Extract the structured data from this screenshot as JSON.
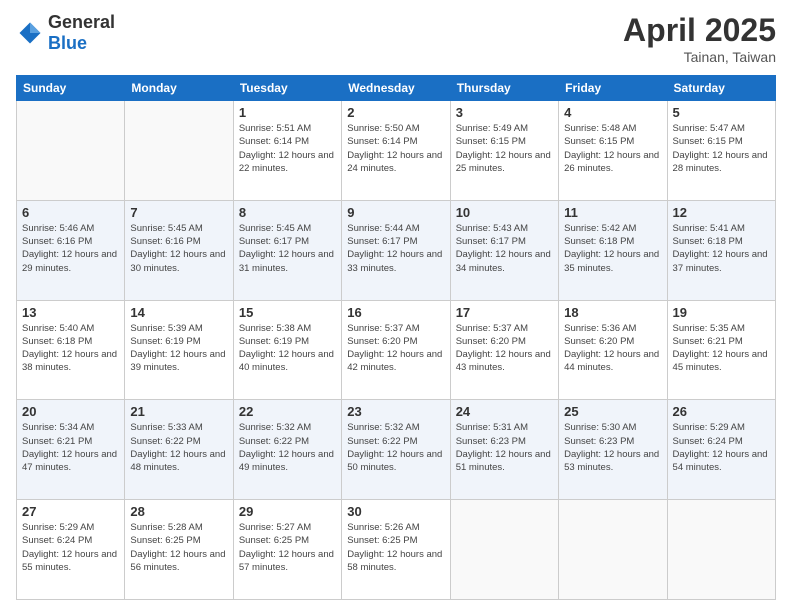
{
  "header": {
    "logo_general": "General",
    "logo_blue": "Blue",
    "title": "April 2025",
    "subtitle": "Tainan, Taiwan"
  },
  "days_of_week": [
    "Sunday",
    "Monday",
    "Tuesday",
    "Wednesday",
    "Thursday",
    "Friday",
    "Saturday"
  ],
  "weeks": [
    {
      "alt": false,
      "days": [
        {
          "num": "",
          "sunrise": "",
          "sunset": "",
          "daylight": ""
        },
        {
          "num": "",
          "sunrise": "",
          "sunset": "",
          "daylight": ""
        },
        {
          "num": "1",
          "sunrise": "Sunrise: 5:51 AM",
          "sunset": "Sunset: 6:14 PM",
          "daylight": "Daylight: 12 hours and 22 minutes."
        },
        {
          "num": "2",
          "sunrise": "Sunrise: 5:50 AM",
          "sunset": "Sunset: 6:14 PM",
          "daylight": "Daylight: 12 hours and 24 minutes."
        },
        {
          "num": "3",
          "sunrise": "Sunrise: 5:49 AM",
          "sunset": "Sunset: 6:15 PM",
          "daylight": "Daylight: 12 hours and 25 minutes."
        },
        {
          "num": "4",
          "sunrise": "Sunrise: 5:48 AM",
          "sunset": "Sunset: 6:15 PM",
          "daylight": "Daylight: 12 hours and 26 minutes."
        },
        {
          "num": "5",
          "sunrise": "Sunrise: 5:47 AM",
          "sunset": "Sunset: 6:15 PM",
          "daylight": "Daylight: 12 hours and 28 minutes."
        }
      ]
    },
    {
      "alt": true,
      "days": [
        {
          "num": "6",
          "sunrise": "Sunrise: 5:46 AM",
          "sunset": "Sunset: 6:16 PM",
          "daylight": "Daylight: 12 hours and 29 minutes."
        },
        {
          "num": "7",
          "sunrise": "Sunrise: 5:45 AM",
          "sunset": "Sunset: 6:16 PM",
          "daylight": "Daylight: 12 hours and 30 minutes."
        },
        {
          "num": "8",
          "sunrise": "Sunrise: 5:45 AM",
          "sunset": "Sunset: 6:17 PM",
          "daylight": "Daylight: 12 hours and 31 minutes."
        },
        {
          "num": "9",
          "sunrise": "Sunrise: 5:44 AM",
          "sunset": "Sunset: 6:17 PM",
          "daylight": "Daylight: 12 hours and 33 minutes."
        },
        {
          "num": "10",
          "sunrise": "Sunrise: 5:43 AM",
          "sunset": "Sunset: 6:17 PM",
          "daylight": "Daylight: 12 hours and 34 minutes."
        },
        {
          "num": "11",
          "sunrise": "Sunrise: 5:42 AM",
          "sunset": "Sunset: 6:18 PM",
          "daylight": "Daylight: 12 hours and 35 minutes."
        },
        {
          "num": "12",
          "sunrise": "Sunrise: 5:41 AM",
          "sunset": "Sunset: 6:18 PM",
          "daylight": "Daylight: 12 hours and 37 minutes."
        }
      ]
    },
    {
      "alt": false,
      "days": [
        {
          "num": "13",
          "sunrise": "Sunrise: 5:40 AM",
          "sunset": "Sunset: 6:18 PM",
          "daylight": "Daylight: 12 hours and 38 minutes."
        },
        {
          "num": "14",
          "sunrise": "Sunrise: 5:39 AM",
          "sunset": "Sunset: 6:19 PM",
          "daylight": "Daylight: 12 hours and 39 minutes."
        },
        {
          "num": "15",
          "sunrise": "Sunrise: 5:38 AM",
          "sunset": "Sunset: 6:19 PM",
          "daylight": "Daylight: 12 hours and 40 minutes."
        },
        {
          "num": "16",
          "sunrise": "Sunrise: 5:37 AM",
          "sunset": "Sunset: 6:20 PM",
          "daylight": "Daylight: 12 hours and 42 minutes."
        },
        {
          "num": "17",
          "sunrise": "Sunrise: 5:37 AM",
          "sunset": "Sunset: 6:20 PM",
          "daylight": "Daylight: 12 hours and 43 minutes."
        },
        {
          "num": "18",
          "sunrise": "Sunrise: 5:36 AM",
          "sunset": "Sunset: 6:20 PM",
          "daylight": "Daylight: 12 hours and 44 minutes."
        },
        {
          "num": "19",
          "sunrise": "Sunrise: 5:35 AM",
          "sunset": "Sunset: 6:21 PM",
          "daylight": "Daylight: 12 hours and 45 minutes."
        }
      ]
    },
    {
      "alt": true,
      "days": [
        {
          "num": "20",
          "sunrise": "Sunrise: 5:34 AM",
          "sunset": "Sunset: 6:21 PM",
          "daylight": "Daylight: 12 hours and 47 minutes."
        },
        {
          "num": "21",
          "sunrise": "Sunrise: 5:33 AM",
          "sunset": "Sunset: 6:22 PM",
          "daylight": "Daylight: 12 hours and 48 minutes."
        },
        {
          "num": "22",
          "sunrise": "Sunrise: 5:32 AM",
          "sunset": "Sunset: 6:22 PM",
          "daylight": "Daylight: 12 hours and 49 minutes."
        },
        {
          "num": "23",
          "sunrise": "Sunrise: 5:32 AM",
          "sunset": "Sunset: 6:22 PM",
          "daylight": "Daylight: 12 hours and 50 minutes."
        },
        {
          "num": "24",
          "sunrise": "Sunrise: 5:31 AM",
          "sunset": "Sunset: 6:23 PM",
          "daylight": "Daylight: 12 hours and 51 minutes."
        },
        {
          "num": "25",
          "sunrise": "Sunrise: 5:30 AM",
          "sunset": "Sunset: 6:23 PM",
          "daylight": "Daylight: 12 hours and 53 minutes."
        },
        {
          "num": "26",
          "sunrise": "Sunrise: 5:29 AM",
          "sunset": "Sunset: 6:24 PM",
          "daylight": "Daylight: 12 hours and 54 minutes."
        }
      ]
    },
    {
      "alt": false,
      "days": [
        {
          "num": "27",
          "sunrise": "Sunrise: 5:29 AM",
          "sunset": "Sunset: 6:24 PM",
          "daylight": "Daylight: 12 hours and 55 minutes."
        },
        {
          "num": "28",
          "sunrise": "Sunrise: 5:28 AM",
          "sunset": "Sunset: 6:25 PM",
          "daylight": "Daylight: 12 hours and 56 minutes."
        },
        {
          "num": "29",
          "sunrise": "Sunrise: 5:27 AM",
          "sunset": "Sunset: 6:25 PM",
          "daylight": "Daylight: 12 hours and 57 minutes."
        },
        {
          "num": "30",
          "sunrise": "Sunrise: 5:26 AM",
          "sunset": "Sunset: 6:25 PM",
          "daylight": "Daylight: 12 hours and 58 minutes."
        },
        {
          "num": "",
          "sunrise": "",
          "sunset": "",
          "daylight": ""
        },
        {
          "num": "",
          "sunrise": "",
          "sunset": "",
          "daylight": ""
        },
        {
          "num": "",
          "sunrise": "",
          "sunset": "",
          "daylight": ""
        }
      ]
    }
  ]
}
